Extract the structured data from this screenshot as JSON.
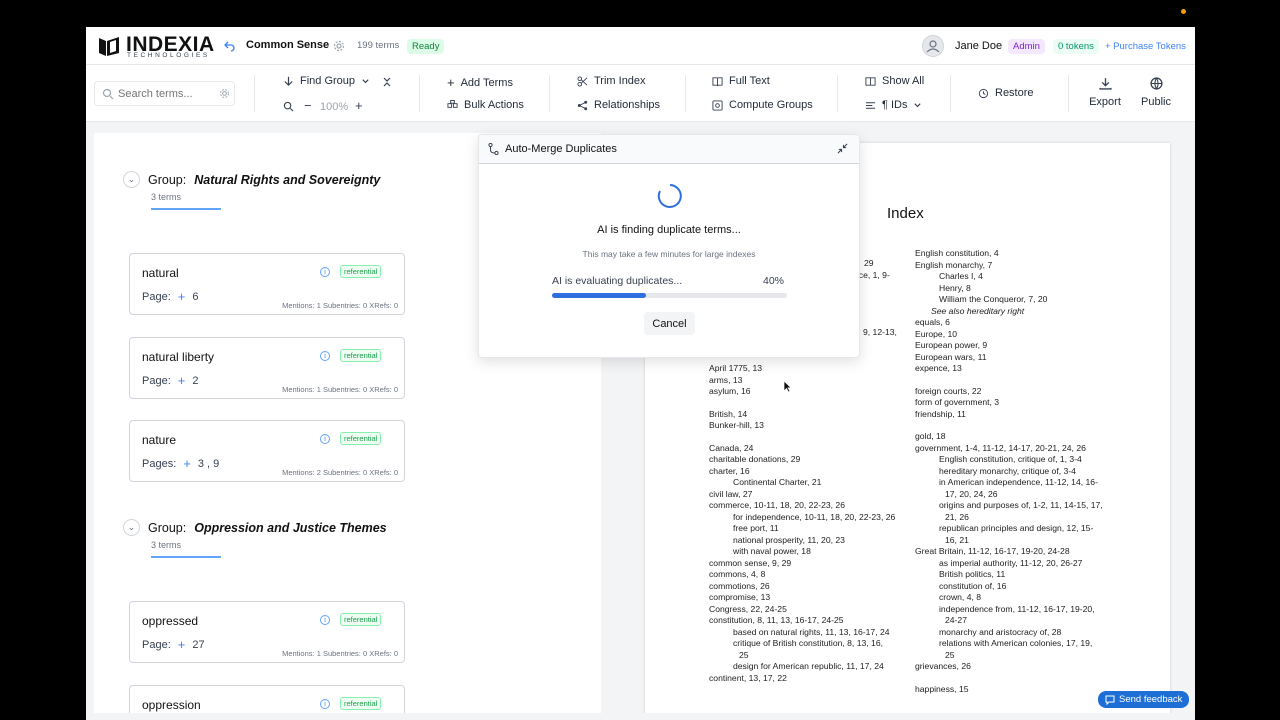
{
  "app": {
    "logo_name": "INDEXIA",
    "logo_sub": "TECHNOLOGIES",
    "project_title": "Common Sense",
    "term_count": "199 terms",
    "status": "Ready"
  },
  "user": {
    "name": "Jane Doe",
    "role": "Admin",
    "tokens": "0 tokens",
    "purchase": "+ Purchase Tokens"
  },
  "toolbar": {
    "search_placeholder": "Search terms...",
    "find_group": "Find Group",
    "zoom": "100%",
    "add_terms": "Add Terms",
    "bulk_actions": "Bulk Actions",
    "trim_index": "Trim Index",
    "relationships": "Relationships",
    "full_text": "Full Text",
    "compute_groups": "Compute Groups",
    "show_all": "Show All",
    "ids": "¶ IDs",
    "restore": "Restore",
    "export": "Export",
    "public": "Public"
  },
  "groups": [
    {
      "label": "Group:",
      "name": "Natural Rights and Sovereignty",
      "count": "3 terms",
      "terms": [
        {
          "name": "natural",
          "pages_label": "Page:",
          "pages": "6",
          "tag": "referential",
          "stats": "Mentions: 1   Subentries: 0   XRefs: 0"
        },
        {
          "name": "natural liberty",
          "pages_label": "Page:",
          "pages": "2",
          "tag": "referential",
          "stats": "Mentions: 1   Subentries: 0   XRefs: 0"
        },
        {
          "name": "nature",
          "pages_label": "Pages:",
          "pages": "3 ,  9",
          "tag": "referential",
          "stats": "Mentions: 2   Subentries: 0   XRefs: 0"
        }
      ]
    },
    {
      "label": "Group:",
      "name": "Oppression and Justice Themes",
      "count": "3 terms",
      "terms": [
        {
          "name": "oppressed",
          "pages_label": "Page:",
          "pages": "27",
          "tag": "referential",
          "stats": "Mentions: 1   Subentries: 0   XRefs: 0"
        },
        {
          "name": "oppression",
          "tag": "referential"
        }
      ]
    }
  ],
  "modal": {
    "title": "Auto-Merge Duplicates",
    "heading": "AI is finding duplicate terms...",
    "subtext": "This may take a few minutes for large indexes",
    "progress_label": "AI is evaluating duplicates...",
    "progress_percent": "40%",
    "progress_value": 0.4,
    "cancel": "Cancel"
  },
  "index_page": {
    "title": "Index",
    "left_col_partial": [
      "29",
      "nce, 1, 9-",
      "9, 12-13,"
    ],
    "left_col": [
      {
        "t": "April 1775, 13",
        "lvl": 0
      },
      {
        "t": "arms, 13",
        "lvl": 0
      },
      {
        "t": "asylum, 16",
        "lvl": 0
      },
      {
        "t": "",
        "lvl": -1
      },
      {
        "t": "British, 14",
        "lvl": 0
      },
      {
        "t": "Bunker-hill, 13",
        "lvl": 0
      },
      {
        "t": "",
        "lvl": -1
      },
      {
        "t": "Canada, 24",
        "lvl": 0
      },
      {
        "t": "charitable donations, 29",
        "lvl": 0
      },
      {
        "t": "charter, 16",
        "lvl": 0
      },
      {
        "t": "Continental Charter, 21",
        "lvl": 1
      },
      {
        "t": "civil law, 27",
        "lvl": 0
      },
      {
        "t": "commerce, 10-11, 18, 20, 22-23, 26",
        "lvl": 0
      },
      {
        "t": "for independence, 10-11, 18, 20, 22-23, 26",
        "lvl": 1
      },
      {
        "t": "free port, 11",
        "lvl": 1
      },
      {
        "t": "national prosperity, 11, 20, 23",
        "lvl": 1
      },
      {
        "t": "with naval power, 18",
        "lvl": 1
      },
      {
        "t": "common sense, 9, 29",
        "lvl": 0
      },
      {
        "t": "commons, 4, 8",
        "lvl": 0
      },
      {
        "t": "commotions, 26",
        "lvl": 0
      },
      {
        "t": "compromise, 13",
        "lvl": 0
      },
      {
        "t": "Congress, 22, 24-25",
        "lvl": 0
      },
      {
        "t": "constitution, 8, 11, 13, 16-17, 24-25",
        "lvl": 0
      },
      {
        "t": "based on natural rights, 11, 13, 16-17, 24",
        "lvl": 1
      },
      {
        "t": "critique of British constitution, 8, 13, 16,",
        "lvl": 1
      },
      {
        "t": "25",
        "lvl": 2
      },
      {
        "t": "design for American republic, 11, 17, 24",
        "lvl": 1
      },
      {
        "t": "continent, 13, 17, 22",
        "lvl": 0
      }
    ],
    "right_col": [
      {
        "t": "English constitution, 4",
        "lvl": 0
      },
      {
        "t": "English monarchy, 7",
        "lvl": 0
      },
      {
        "t": "Charles I, 4",
        "lvl": 1
      },
      {
        "t": "Henry, 8",
        "lvl": 1
      },
      {
        "t": "William the Conqueror, 7, 20",
        "lvl": 1
      },
      {
        "t": "See also hereditary right",
        "lvl": 3
      },
      {
        "t": "equals, 6",
        "lvl": 0
      },
      {
        "t": "Europe, 10",
        "lvl": 0
      },
      {
        "t": "European power, 9",
        "lvl": 0
      },
      {
        "t": "European wars, 11",
        "lvl": 0
      },
      {
        "t": "expence, 13",
        "lvl": 0
      },
      {
        "t": "",
        "lvl": -1
      },
      {
        "t": "foreign courts, 22",
        "lvl": 0
      },
      {
        "t": "form of government, 3",
        "lvl": 0
      },
      {
        "t": "friendship, 11",
        "lvl": 0
      },
      {
        "t": "",
        "lvl": -1
      },
      {
        "t": "gold, 18",
        "lvl": 0
      },
      {
        "t": "government, 1-4, 11-12, 14-17, 20-21, 24, 26",
        "lvl": 0
      },
      {
        "t": "English constitution, critique of, 1, 3-4",
        "lvl": 1
      },
      {
        "t": "hereditary monarchy, critique of, 3-4",
        "lvl": 1
      },
      {
        "t": "in American independence, 11-12, 14, 16-",
        "lvl": 1
      },
      {
        "t": "17, 20, 24, 26",
        "lvl": 2
      },
      {
        "t": "origins and purposes of, 1-2, 11, 14-15, 17,",
        "lvl": 1
      },
      {
        "t": "21, 26",
        "lvl": 2
      },
      {
        "t": "republican principles and design, 12, 15-",
        "lvl": 1
      },
      {
        "t": "16, 21",
        "lvl": 2
      },
      {
        "t": "Great Britain, 11-12, 16-17, 19-20, 24-28",
        "lvl": 0
      },
      {
        "t": "as imperial authority, 11-12, 20, 26-27",
        "lvl": 1
      },
      {
        "t": "British politics, 11",
        "lvl": 1
      },
      {
        "t": "constitution of, 16",
        "lvl": 1
      },
      {
        "t": "crown, 4, 8",
        "lvl": 1
      },
      {
        "t": "independence from, 11-12, 16-17, 19-20,",
        "lvl": 1
      },
      {
        "t": "24-27",
        "lvl": 2
      },
      {
        "t": "monarchy and aristocracy of, 28",
        "lvl": 1
      },
      {
        "t": "relations with American colonies, 17, 19,",
        "lvl": 1
      },
      {
        "t": "25",
        "lvl": 2
      },
      {
        "t": "grievances, 26",
        "lvl": 0
      },
      {
        "t": "",
        "lvl": -1
      },
      {
        "t": "happiness, 15",
        "lvl": 0
      }
    ]
  },
  "feedback": "Send feedback",
  "colors": {
    "accent": "#3b82f6",
    "progress": "#2f6fe0",
    "ready_bg": "#dcfce7",
    "feedback_bg": "#1d6fd6"
  }
}
